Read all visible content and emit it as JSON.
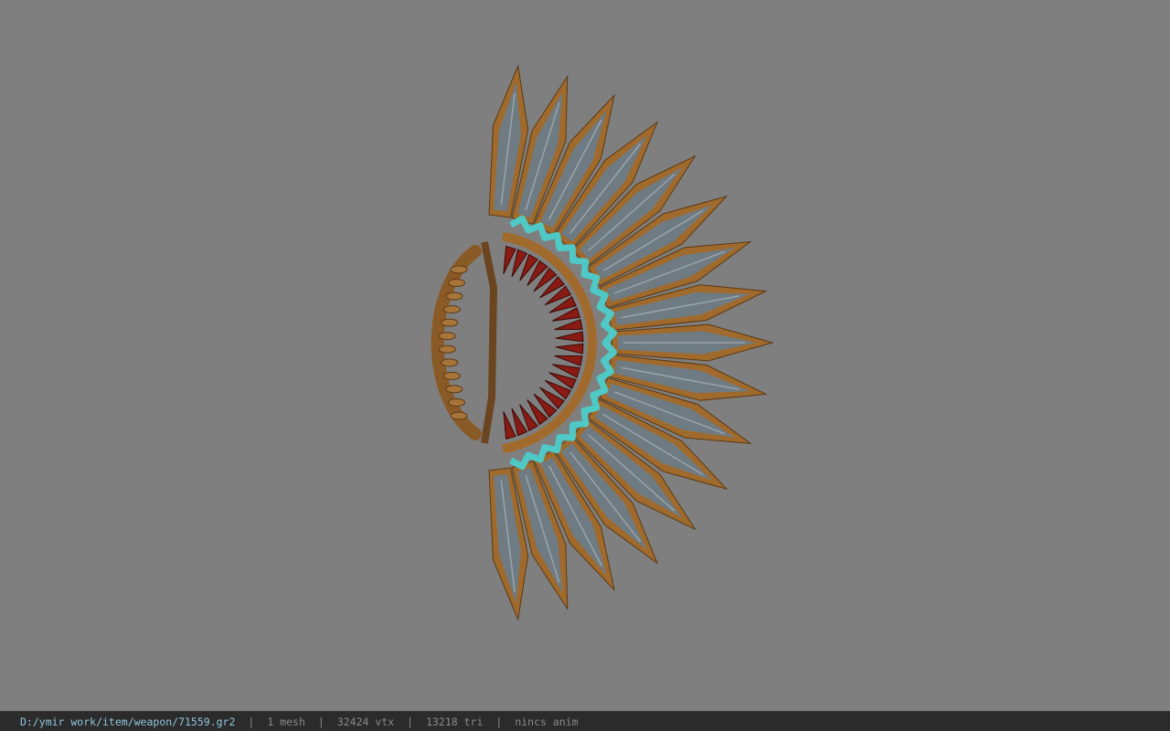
{
  "viewer": {
    "background_color": "#7f7f7f",
    "model_icon": "fan-blade-weapon-model"
  },
  "status": {
    "file_path": "D:/ymir work/item/weapon/71559.gr2",
    "mesh": "1 mesh",
    "vertices": "32424 vtx",
    "triangles": "13218 tri",
    "animation": "nincs anim",
    "separator": "|"
  },
  "colors": {
    "blade_steel": "#6f7b82",
    "blade_edge": "#a06a2c",
    "ring_teal": "#4fc9c6",
    "inner_red": "#8a1a14",
    "status_path": "#8ec7de"
  }
}
